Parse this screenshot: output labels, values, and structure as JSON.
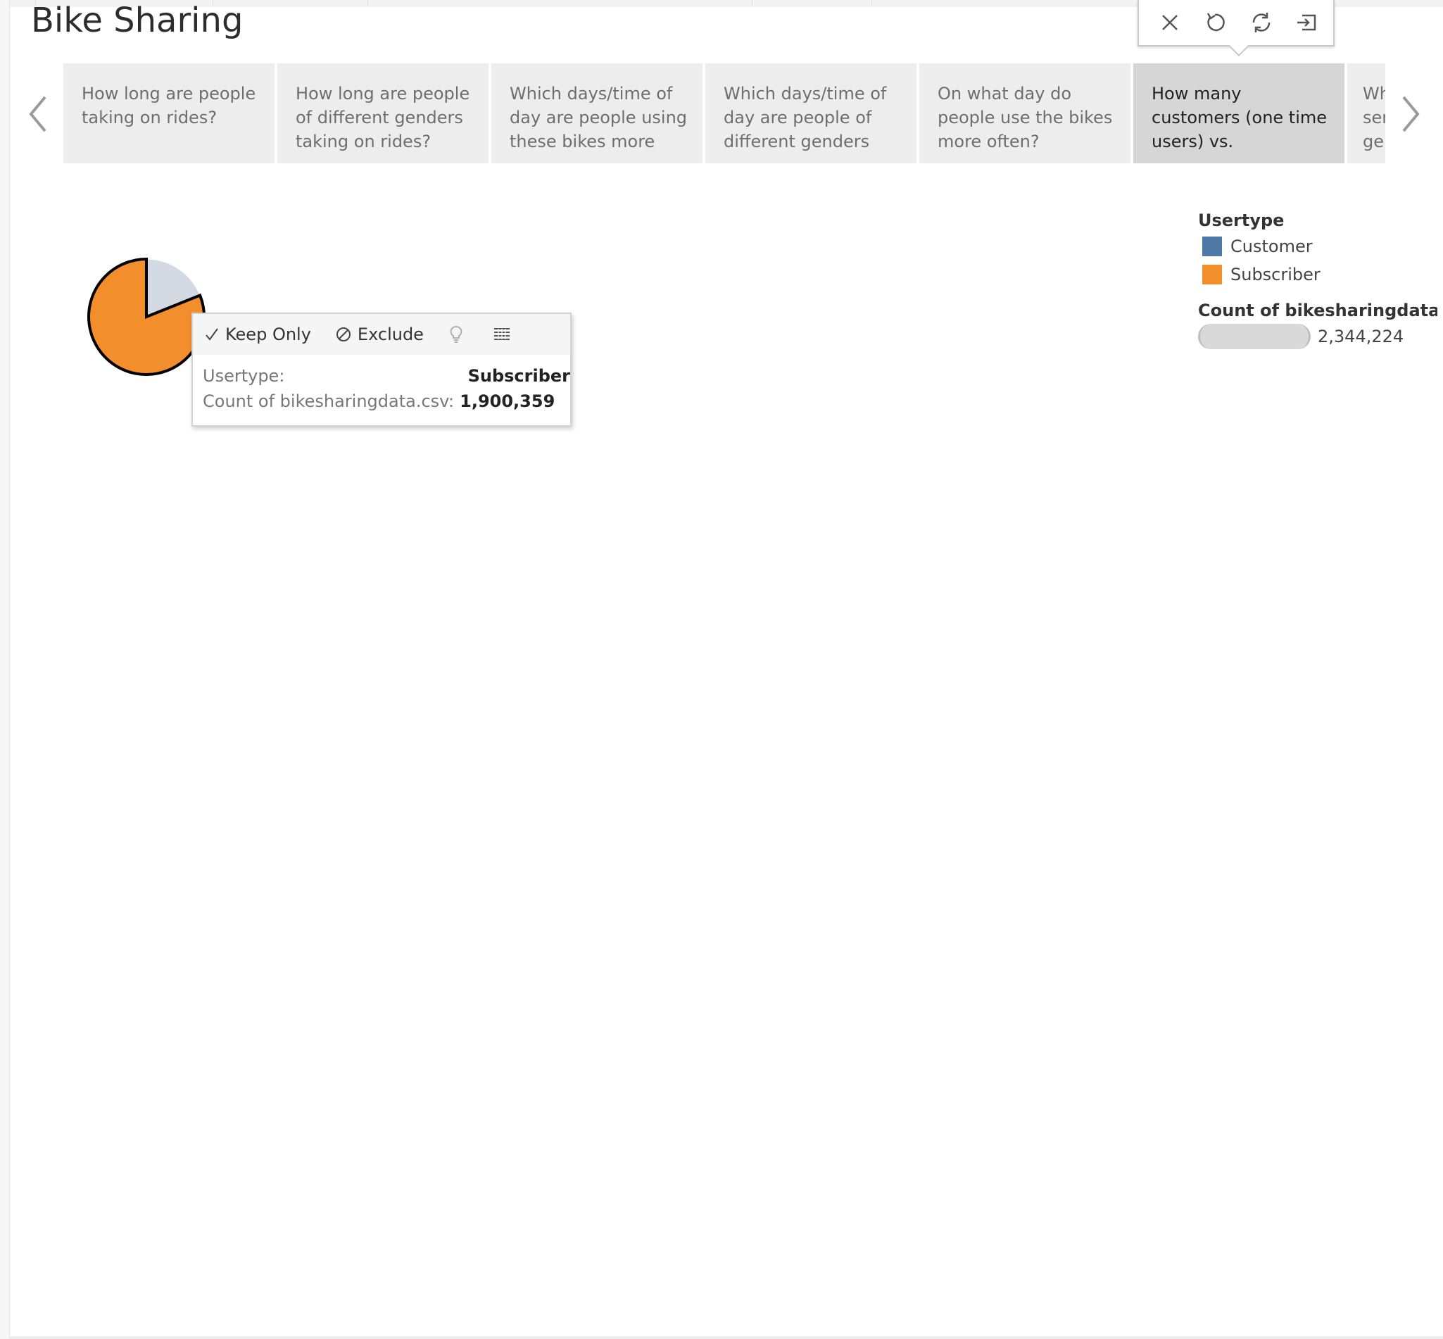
{
  "dashboard": {
    "title": "Bike Sharing"
  },
  "toolbar": {
    "buttons": [
      {
        "name": "close-icon"
      },
      {
        "name": "undo-icon"
      },
      {
        "name": "refresh-icon"
      },
      {
        "name": "exit-icon"
      }
    ]
  },
  "story": {
    "points": [
      {
        "label": "How long are people taking on rides?"
      },
      {
        "label": "How long are people of different genders taking on rides?"
      },
      {
        "label": "Which days/time of day are people using these bikes more"
      },
      {
        "label": "Which days/time of day are people of different genders"
      },
      {
        "label": "On what day do people use the bikes more often?"
      },
      {
        "label": "How many customers (one time users) vs. subscribers (paying",
        "active": true
      },
      {
        "label": "Wh ser ge"
      }
    ],
    "prev_icon": "chevron-left-icon",
    "next_icon": "chevron-right-icon"
  },
  "legend": {
    "title": "Usertype",
    "items": [
      {
        "label": "Customer",
        "color": "#4e79a7"
      },
      {
        "label": "Subscriber",
        "color": "#f28e2b"
      }
    ],
    "size_title": "Count of bikesharingdata..",
    "size_value": "2,344,224"
  },
  "tooltip": {
    "keep_only": "Keep Only",
    "exclude": "Exclude",
    "rows": [
      {
        "key": "Usertype:",
        "value": "Subscriber"
      },
      {
        "key": "Count of bikesharingdata.csv:",
        "value": "1,900,359"
      }
    ]
  },
  "chart_data": {
    "type": "pie",
    "categories": [
      "Customer",
      "Subscriber"
    ],
    "values": [
      443865,
      1900359
    ],
    "colors": [
      "#d3dae3",
      "#f28e2b"
    ],
    "selected": "Subscriber",
    "total": 2344224
  }
}
